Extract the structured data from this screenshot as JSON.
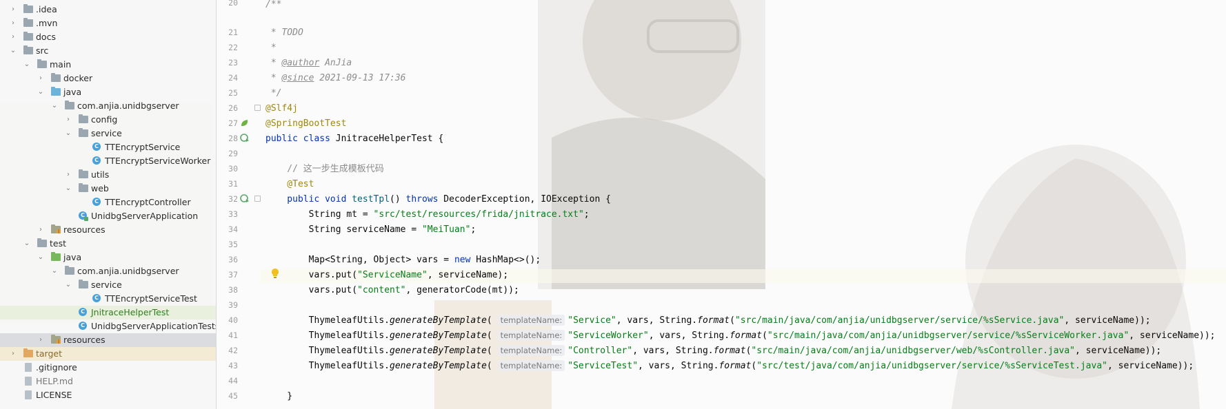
{
  "sidebar": {
    "items": [
      {
        "label": ".idea",
        "depth": 1,
        "kind": "folder",
        "expanded": false
      },
      {
        "label": ".mvn",
        "depth": 1,
        "kind": "folder",
        "expanded": false
      },
      {
        "label": "docs",
        "depth": 1,
        "kind": "folder",
        "expanded": false
      },
      {
        "label": "src",
        "depth": 1,
        "kind": "folder",
        "expanded": true
      },
      {
        "label": "main",
        "depth": 2,
        "kind": "folder",
        "expanded": true
      },
      {
        "label": "docker",
        "depth": 3,
        "kind": "folder",
        "expanded": false
      },
      {
        "label": "java",
        "depth": 3,
        "kind": "src",
        "expanded": true
      },
      {
        "label": "com.anjia.unidbgserver",
        "depth": 4,
        "kind": "folder",
        "expanded": true
      },
      {
        "label": "config",
        "depth": 5,
        "kind": "folder",
        "expanded": false
      },
      {
        "label": "service",
        "depth": 5,
        "kind": "folder",
        "expanded": true
      },
      {
        "label": "TTEncryptService",
        "depth": 6,
        "kind": "class"
      },
      {
        "label": "TTEncryptServiceWorker",
        "depth": 6,
        "kind": "class"
      },
      {
        "label": "utils",
        "depth": 5,
        "kind": "folder",
        "expanded": false
      },
      {
        "label": "web",
        "depth": 5,
        "kind": "folder",
        "expanded": true
      },
      {
        "label": "TTEncryptController",
        "depth": 6,
        "kind": "class"
      },
      {
        "label": "UnidbgServerApplication",
        "depth": 5,
        "kind": "app"
      },
      {
        "label": "resources",
        "depth": 3,
        "kind": "res",
        "expanded": false
      },
      {
        "label": "test",
        "depth": 2,
        "kind": "folder",
        "expanded": true
      },
      {
        "label": "java",
        "depth": 3,
        "kind": "test",
        "expanded": true
      },
      {
        "label": "com.anjia.unidbgserver",
        "depth": 4,
        "kind": "folder",
        "expanded": true
      },
      {
        "label": "service",
        "depth": 5,
        "kind": "folder",
        "expanded": true
      },
      {
        "label": "TTEncryptServiceTest",
        "depth": 6,
        "kind": "class"
      },
      {
        "label": "JnitraceHelperTest",
        "depth": 5,
        "kind": "class",
        "active": true
      },
      {
        "label": "UnidbgServerApplicationTests",
        "depth": 5,
        "kind": "class"
      },
      {
        "label": "resources",
        "depth": 3,
        "kind": "res",
        "expanded": false,
        "selected": true
      },
      {
        "label": "target",
        "depth": 1,
        "kind": "excl",
        "expanded": false
      },
      {
        "label": ".gitignore",
        "depth": 1,
        "kind": "file"
      },
      {
        "label": "HELP.md",
        "depth": 1,
        "kind": "file"
      },
      {
        "label": "LICENSE",
        "depth": 1,
        "kind": "file"
      }
    ]
  },
  "editor": {
    "line_numbers": [
      "20",
      "21",
      "22",
      "23",
      "24",
      "25",
      "26",
      "27",
      "28",
      "29",
      "30",
      "31",
      "32",
      "33",
      "34",
      "35",
      "36",
      "37",
      "38",
      "39",
      "40",
      "41",
      "42",
      "43",
      "44",
      "45"
    ],
    "lines": {
      "l20": "/**",
      "l21": " * TODO",
      "l22": " *",
      "l23_prefix": " * ",
      "l23_tag": "@author",
      "l23_rest": " AnJia",
      "l24_prefix": " * ",
      "l24_tag": "@since",
      "l24_rest": " 2021-09-13 17:36",
      "l25": " */",
      "l26": "@Slf4j",
      "l27": "@SpringBootTest",
      "l28_kw": "public class",
      "l28_rest": " JnitraceHelperTest {",
      "l30": "    // 这一步生成模板代码",
      "l31": "    @Test",
      "l32_kw": "    public void",
      "l32_mth": " testTpl",
      "l32_rest": "() ",
      "l32_kw2": "throws",
      "l32_rest2": " DecoderException, IOException {",
      "l33_a": "        String mt = ",
      "l33_str": "\"src/test/resources/frida/jnitrace.txt\"",
      "l33_b": ";",
      "l34_a": "        String serviceName = ",
      "l34_str": "\"MeiTuan\"",
      "l34_b": ";",
      "l36_a": "        Map<String, Object> vars = ",
      "l36_kw": "new",
      "l36_b": " HashMap<>();",
      "l37_a": "        vars.put(",
      "l37_str": "\"ServiceName\"",
      "l37_b": ", serviceName);",
      "l38_a": "        vars.put(",
      "l38_str": "\"content\"",
      "l38_b": ", generatorCode(mt));",
      "gen_prefix": "        ThymeleafUtils.",
      "gen_method": "generateByTemplate",
      "hint": "templateName:",
      "l40_name": "\"Service\"",
      "l40_path": "\"src/main/java/com/anjia/unidbgserver/service/%sService.java\"",
      "l41_name": "\"ServiceWorker\"",
      "l41_path": "\"src/main/java/com/anjia/unidbgserver/service/%sServiceWorker.java\"",
      "l42_name": "\"Controller\"",
      "l42_path": "\"src/main/java/com/anjia/unidbgserver/web/%sController.java\"",
      "l43_name": "\"ServiceTest\"",
      "l43_path": "\"src/test/java/com/anjia/unidbgserver/service/%sServiceTest.java\"",
      "mid": ", vars, String.",
      "format": "format",
      "open": "(",
      "tail": ", serviceName));",
      "l45": "    }"
    }
  },
  "colors": {
    "keyword": "#0033b3",
    "string": "#067d17",
    "annotation": "#9e880d",
    "comment": "#8c8c8c",
    "class_icon": "#47a0d7"
  }
}
